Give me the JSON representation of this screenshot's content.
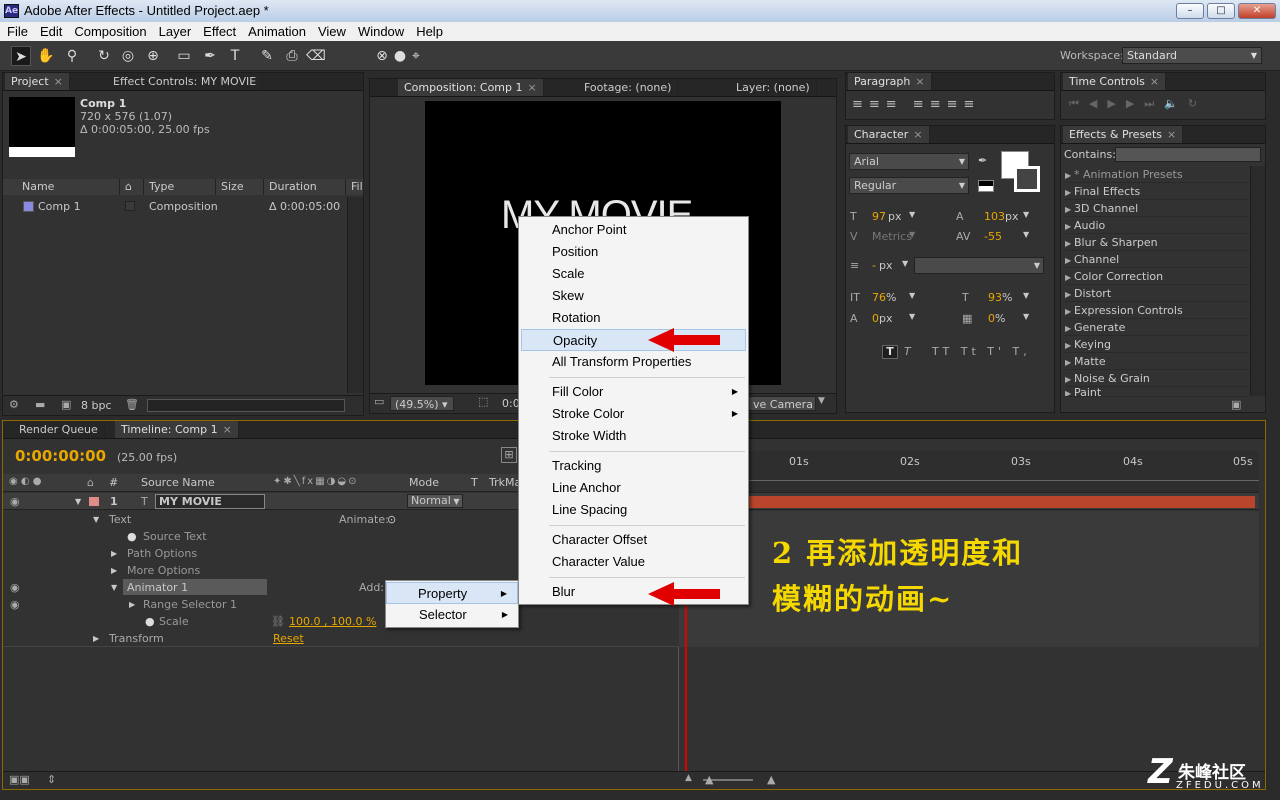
{
  "window": {
    "title": "Adobe After Effects - Untitled Project.aep *",
    "app_icon": "Ae",
    "minimize": "–",
    "maximize": "□",
    "close": "✕"
  },
  "menubar": [
    "File",
    "Edit",
    "Composition",
    "Layer",
    "Effect",
    "Animation",
    "View",
    "Window",
    "Help"
  ],
  "toolbar": {
    "workspace_label": "Workspace:",
    "workspace_value": "Standard"
  },
  "project_panel": {
    "tab_project": "Project",
    "tab_effect_controls": "Effect Controls: MY MOVIE",
    "comp_name": "Comp 1",
    "comp_dims": "720 x 576 (1.07)",
    "comp_duration": "Δ 0:00:05:00, 25.00 fps",
    "columns": [
      "Name",
      "Type",
      "Size",
      "Duration",
      "Fil"
    ],
    "items": [
      {
        "name": "Comp 1",
        "type": "Composition",
        "size": "",
        "duration": "Δ 0:00:05:00"
      }
    ],
    "bpc": "8 bpc"
  },
  "comp_viewer": {
    "tab_comp": "Composition: Comp 1",
    "tab_footage": "Footage: (none)",
    "tab_layer": "Layer: (none)",
    "canvas_text": "MY MOVIE",
    "zoom": "(49.5%)",
    "time_partial": "0:0",
    "camera_partial": "ve Camera"
  },
  "paragraph_panel": {
    "tab": "Paragraph"
  },
  "character_panel": {
    "tab": "Character",
    "font": "Arial",
    "style": "Regular",
    "size": "97",
    "size_unit": "px",
    "leading": "103",
    "leading_unit": "px",
    "kerning": "Metrics",
    "tracking": "-55",
    "stroke": "-",
    "stroke_unit": "px",
    "vscale": "76",
    "hscale": "93",
    "baseline": "0",
    "baseline_unit": "px",
    "tsume": "0",
    "pct": "%"
  },
  "time_controls": {
    "tab": "Time Controls"
  },
  "effects_presets": {
    "tab": "Effects & Presets",
    "contains_label": "Contains:",
    "items": [
      "* Animation Presets",
      "Final Effects",
      "3D Channel",
      "Audio",
      "Blur & Sharpen",
      "Channel",
      "Color Correction",
      "Distort",
      "Expression Controls",
      "Generate",
      "Keying",
      "Matte",
      "Noise & Grain",
      "Paint"
    ]
  },
  "timeline": {
    "tab_render": "Render Queue",
    "tab_timeline": "Timeline: Comp 1",
    "timecode": "0:00:00:00",
    "fps": "(25.00 fps)",
    "col_num": "#",
    "col_source": "Source Name",
    "col_mode": "Mode",
    "col_t": "T",
    "col_trkmat": "TrkMa",
    "layer_num": "1",
    "layer_type": "T",
    "layer_name": "MY MOVIE",
    "layer_mode": "Normal",
    "prop_text": "Text",
    "animate_label": "Animate:",
    "prop_source_text": "Source Text",
    "prop_path": "Path Options",
    "prop_more": "More Options",
    "prop_animator": "Animator 1",
    "add_label": "Add:",
    "prop_range": "Range Selector 1",
    "prop_scale": "Scale",
    "scale_value": "100.0 , 100.0 %",
    "prop_transform": "Transform",
    "reset": "Reset",
    "ruler": [
      "01s",
      "02s",
      "03s",
      "04s",
      "05s"
    ]
  },
  "submenu_add": {
    "items": [
      "Property",
      "Selector"
    ]
  },
  "context_menu": {
    "group1": [
      "Anchor Point",
      "Position",
      "Scale",
      "Skew",
      "Rotation",
      "Opacity",
      "All Transform Properties"
    ],
    "group2": [
      "Fill Color",
      "Stroke Color",
      "Stroke Width"
    ],
    "group3": [
      "Tracking",
      "Line Anchor",
      "Line Spacing"
    ],
    "group4": [
      "Character Offset",
      "Character Value"
    ],
    "group5": [
      "Blur"
    ]
  },
  "annotation": {
    "line1": "2 再添加透明度和",
    "line2": "模糊的动画~"
  },
  "watermark": {
    "text": "朱峰社区",
    "url": "ZFEDU.COM"
  },
  "colors": {
    "accent_orange": "#e8a800",
    "layer_bar": "#b8452c",
    "arrow_red": "#e00000",
    "annotation_yellow": "#f5d800",
    "playhead": "#e00000"
  }
}
